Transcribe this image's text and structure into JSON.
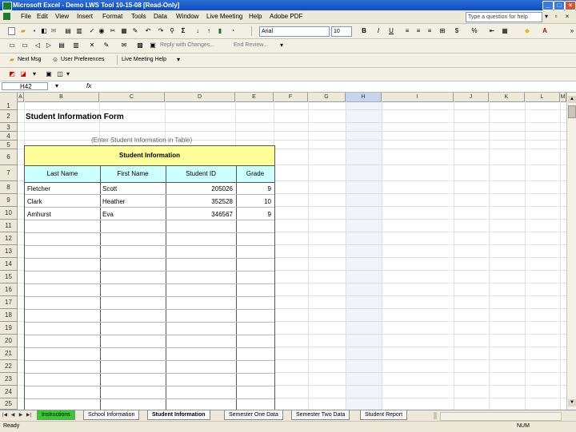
{
  "window": {
    "title": "Microsoft Excel - Demo LWS Tool 10-15-08 [Read-Only]",
    "minimize": "_",
    "maximize": "□",
    "close": "×"
  },
  "menu": {
    "items": [
      "File",
      "Edit",
      "View",
      "Insert",
      "Format",
      "Tools",
      "Data",
      "Window",
      "Live Meeting",
      "Help",
      "Adobe PDF"
    ],
    "help_placeholder": "Type a question for help"
  },
  "toolbar": {
    "font_name": "Arial",
    "font_size": "10",
    "sum_symbol": "Σ",
    "bold": "B",
    "italic": "I",
    "underline": "U",
    "currency": "$",
    "percent": "%",
    "reply_changes": "Reply with Changes...",
    "end_review": "End Review...",
    "next_msg": "Next Msg",
    "user_preferences": "User Preferences",
    "live_meeting_help": "Live Meeting Help"
  },
  "formula_bar": {
    "name_box": "H42",
    "fx": "fx",
    "content": ""
  },
  "columns": [
    "A",
    "B",
    "C",
    "D",
    "E",
    "F",
    "G",
    "H",
    "I",
    "J",
    "K",
    "L",
    "M"
  ],
  "selected_column": "H",
  "rows": [
    "1",
    "2",
    "3",
    "4",
    "5",
    "6",
    "7",
    "8",
    "9",
    "10",
    "11",
    "12",
    "13",
    "14",
    "15",
    "16",
    "17",
    "18",
    "19",
    "20",
    "21",
    "22",
    "23",
    "24",
    "25"
  ],
  "sheet": {
    "form_title": "Student Information Form",
    "subtitle": "(Enter Student Information in Table)",
    "table_title": "Student Information",
    "headers": [
      "Last Name",
      "First Name",
      "Student ID",
      "Grade"
    ],
    "students": [
      {
        "last": "Fletcher",
        "first": "Scott",
        "id": "205026",
        "grade": "9"
      },
      {
        "last": "Clark",
        "first": "Heather",
        "id": "352528",
        "grade": "10"
      },
      {
        "last": "Amhurst",
        "first": "Eva",
        "id": "346567",
        "grade": "9"
      }
    ]
  },
  "tabs": [
    "Instructions",
    "School Information",
    "Student Information",
    "Semester One Data",
    "Semester Two Data",
    "Student Report"
  ],
  "active_tab": "Student Information",
  "status": {
    "left": "Ready",
    "right": "NUM"
  },
  "colors": {
    "table_title_bg": "#ffff99",
    "header_bg": "#ccffff",
    "instructions_tab": "#33cc33",
    "selection": "#c7d4ee"
  }
}
